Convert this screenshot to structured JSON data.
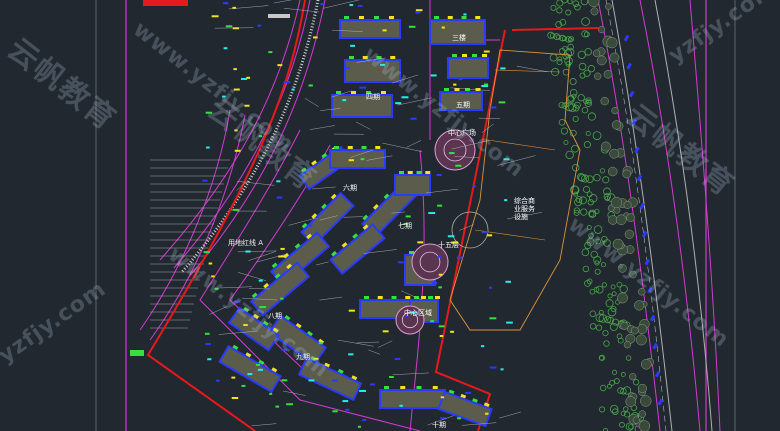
{
  "app": {
    "background": "#212830"
  },
  "drawing": {
    "labels": {
      "building_3": "三楼",
      "building_4": "四期",
      "building_5": "五期",
      "building_6": "六期",
      "building_7": "七期",
      "building_8": "八期",
      "building_9": "九期",
      "building_10": "十期",
      "square_a": "中心广场",
      "square_b": "十五层",
      "square_c": "中心区域",
      "commercial": "综合商业服务设施",
      "site_note": "用地红线 A"
    }
  },
  "watermark": {
    "url_text": "www.yzfjy.com",
    "url_text_short": "yzfjy.com",
    "cn_text": "云帆教育"
  },
  "colors": {
    "bg": "#212830",
    "road_magenta": "#d23bd2",
    "property_red": "#e8191b",
    "building_blue": "#2a3bff",
    "building_fill": "#5b5c4b",
    "yellow": "#f2e31a",
    "green": "#33e13b",
    "cyan": "#1ff0ef",
    "white_line": "#c8c8c8",
    "orange": "#e0933a",
    "tree_green": "#4aa64a"
  }
}
